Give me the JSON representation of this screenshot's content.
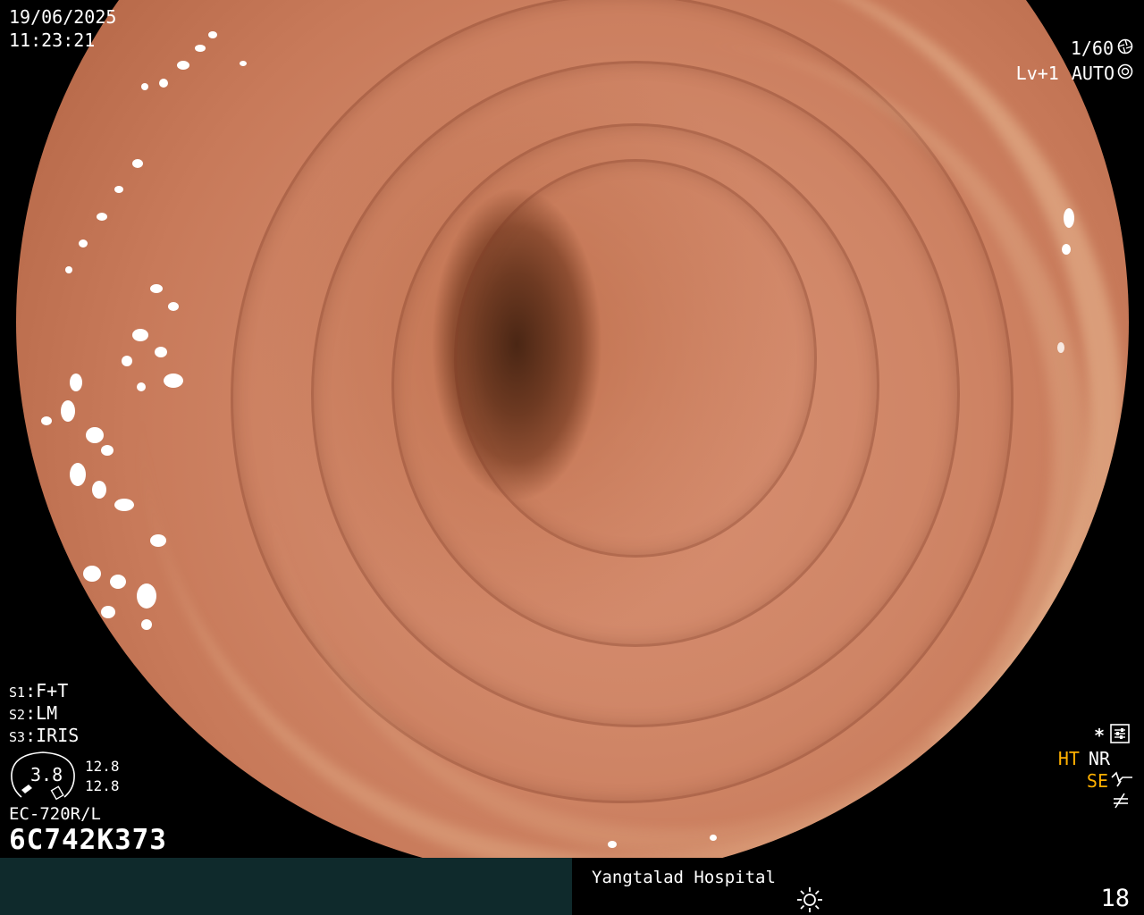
{
  "header": {
    "date": "19/06/2025",
    "time": "11:23:21",
    "shutter": "1/60",
    "level": "Lv+1",
    "exposure_mode": "AUTO"
  },
  "settings": {
    "s1": {
      "key": "S1",
      "value": "F+T"
    },
    "s2": {
      "key": "S2",
      "value": "LM"
    },
    "s3": {
      "key": "S3",
      "value": "IRIS"
    }
  },
  "gauge": {
    "value": "3.8",
    "reading_top": "12.8",
    "reading_bottom": "12.8"
  },
  "scope": {
    "model": "EC-720R/L",
    "serial": "6C742K373"
  },
  "status_right": {
    "star": "*",
    "ht": "HT",
    "nr": "NR",
    "se": "SE"
  },
  "footer": {
    "hospital": "Yangtalad Hospital",
    "counter": "18"
  },
  "icons": [
    "aperture-icon",
    "sun-icon",
    "settings-sliders-icon",
    "structure-enhance-icon",
    "color-mode-icon",
    "brightness-icon"
  ],
  "colors": {
    "text": "#ffffff",
    "accent_orange": "#ffb000",
    "footer_left_bg": "#0f2a2c"
  }
}
